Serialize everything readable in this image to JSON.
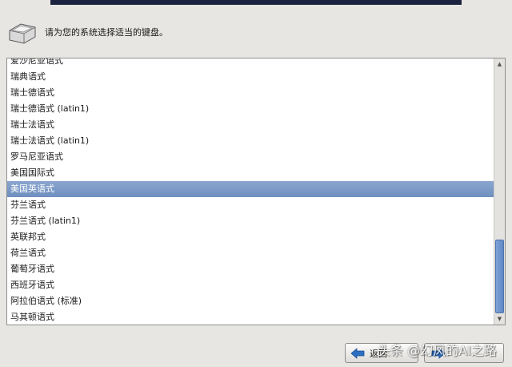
{
  "header": {
    "label": "请为您的系统选择适当的键盘。",
    "icon": "keyboard-key-icon"
  },
  "keyboards": [
    "爱沙尼亚语式",
    "瑞典语式",
    "瑞士德语式",
    "瑞士德语式 (latin1)",
    "瑞士法语式",
    "瑞士法语式 (latin1)",
    "罗马尼亚语式",
    "美国国际式",
    "美国英语式",
    "芬兰语式",
    "芬兰语式 (latin1)",
    "英联邦式",
    "荷兰语式",
    "葡萄牙语式",
    "西班牙语式",
    "阿拉伯语式 (标准)",
    "马其顿语式"
  ],
  "selected_index": 8,
  "buttons": {
    "back_label": "返回",
    "back_icon": "arrow-left-icon",
    "next_icon": "arrow-right-icon"
  },
  "watermark": "头条 @幻风的AI之路",
  "colors": {
    "selection": "#7a98c6",
    "scroll_thumb": "#6f93cc",
    "arrow": "#2d6fc2"
  }
}
